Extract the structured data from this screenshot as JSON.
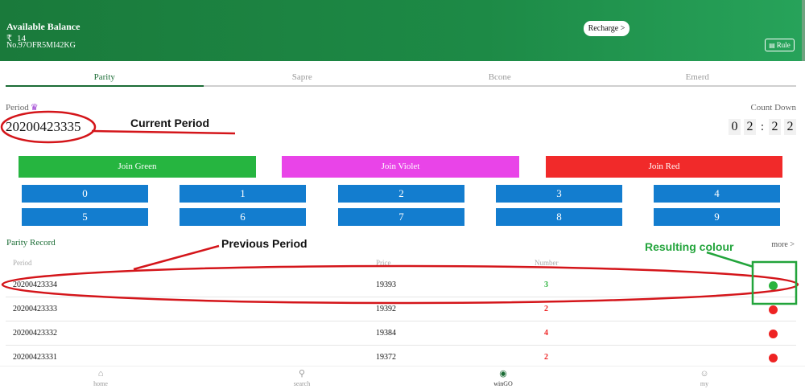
{
  "header": {
    "balance_label": "Available Balance",
    "currency": "₹",
    "balance": "14",
    "account_no": "No.97OFR5MI42KG",
    "recharge_label": "Recharge >",
    "rule_label": "Rule"
  },
  "tabs": [
    {
      "label": "Parity",
      "active": true
    },
    {
      "label": "Sapre",
      "active": false
    },
    {
      "label": "Bcone",
      "active": false
    },
    {
      "label": "Emerd",
      "active": false
    }
  ],
  "period": {
    "label": "Period",
    "value": "20200423335"
  },
  "countdown": {
    "label": "Count Down",
    "digits": [
      "0",
      "2",
      "2",
      "2"
    ],
    "separator": ":"
  },
  "join": {
    "green": "Join Green",
    "violet": "Join Violet",
    "red": "Join Red"
  },
  "numbers": [
    "0",
    "1",
    "2",
    "3",
    "4",
    "5",
    "6",
    "7",
    "8",
    "9"
  ],
  "record": {
    "title": "Parity Record",
    "more_label": "more >",
    "headers": {
      "period": "Period",
      "price": "Price",
      "number": "Number"
    },
    "rows": [
      {
        "period": "20200423334",
        "price": "19393",
        "number": "3",
        "result_color": "#2bb33d"
      },
      {
        "period": "20200423333",
        "price": "19392",
        "number": "2",
        "result_color": "#ee2323"
      },
      {
        "period": "20200423332",
        "price": "19384",
        "number": "4",
        "result_color": "#ee2323"
      },
      {
        "period": "20200423331",
        "price": "19372",
        "number": "2",
        "result_color": "#ee2323"
      }
    ]
  },
  "annotations": {
    "current_period": "Current Period",
    "previous_period": "Previous Period",
    "resulting_colour": "Resulting colour"
  },
  "bottom_nav": [
    {
      "label": "home",
      "icon": "home-icon",
      "active": false
    },
    {
      "label": "search",
      "icon": "search-icon",
      "active": false
    },
    {
      "label": "winGO",
      "icon": "wingo-icon",
      "active": true
    },
    {
      "label": "my",
      "icon": "user-icon",
      "active": false
    }
  ],
  "colors": {
    "header_green": "#1d8a46",
    "join_green": "#26b540",
    "join_violet": "#e944e8",
    "join_red": "#f12a2a",
    "number_blue": "#137dcf",
    "annotation_red": "#d4151a"
  }
}
